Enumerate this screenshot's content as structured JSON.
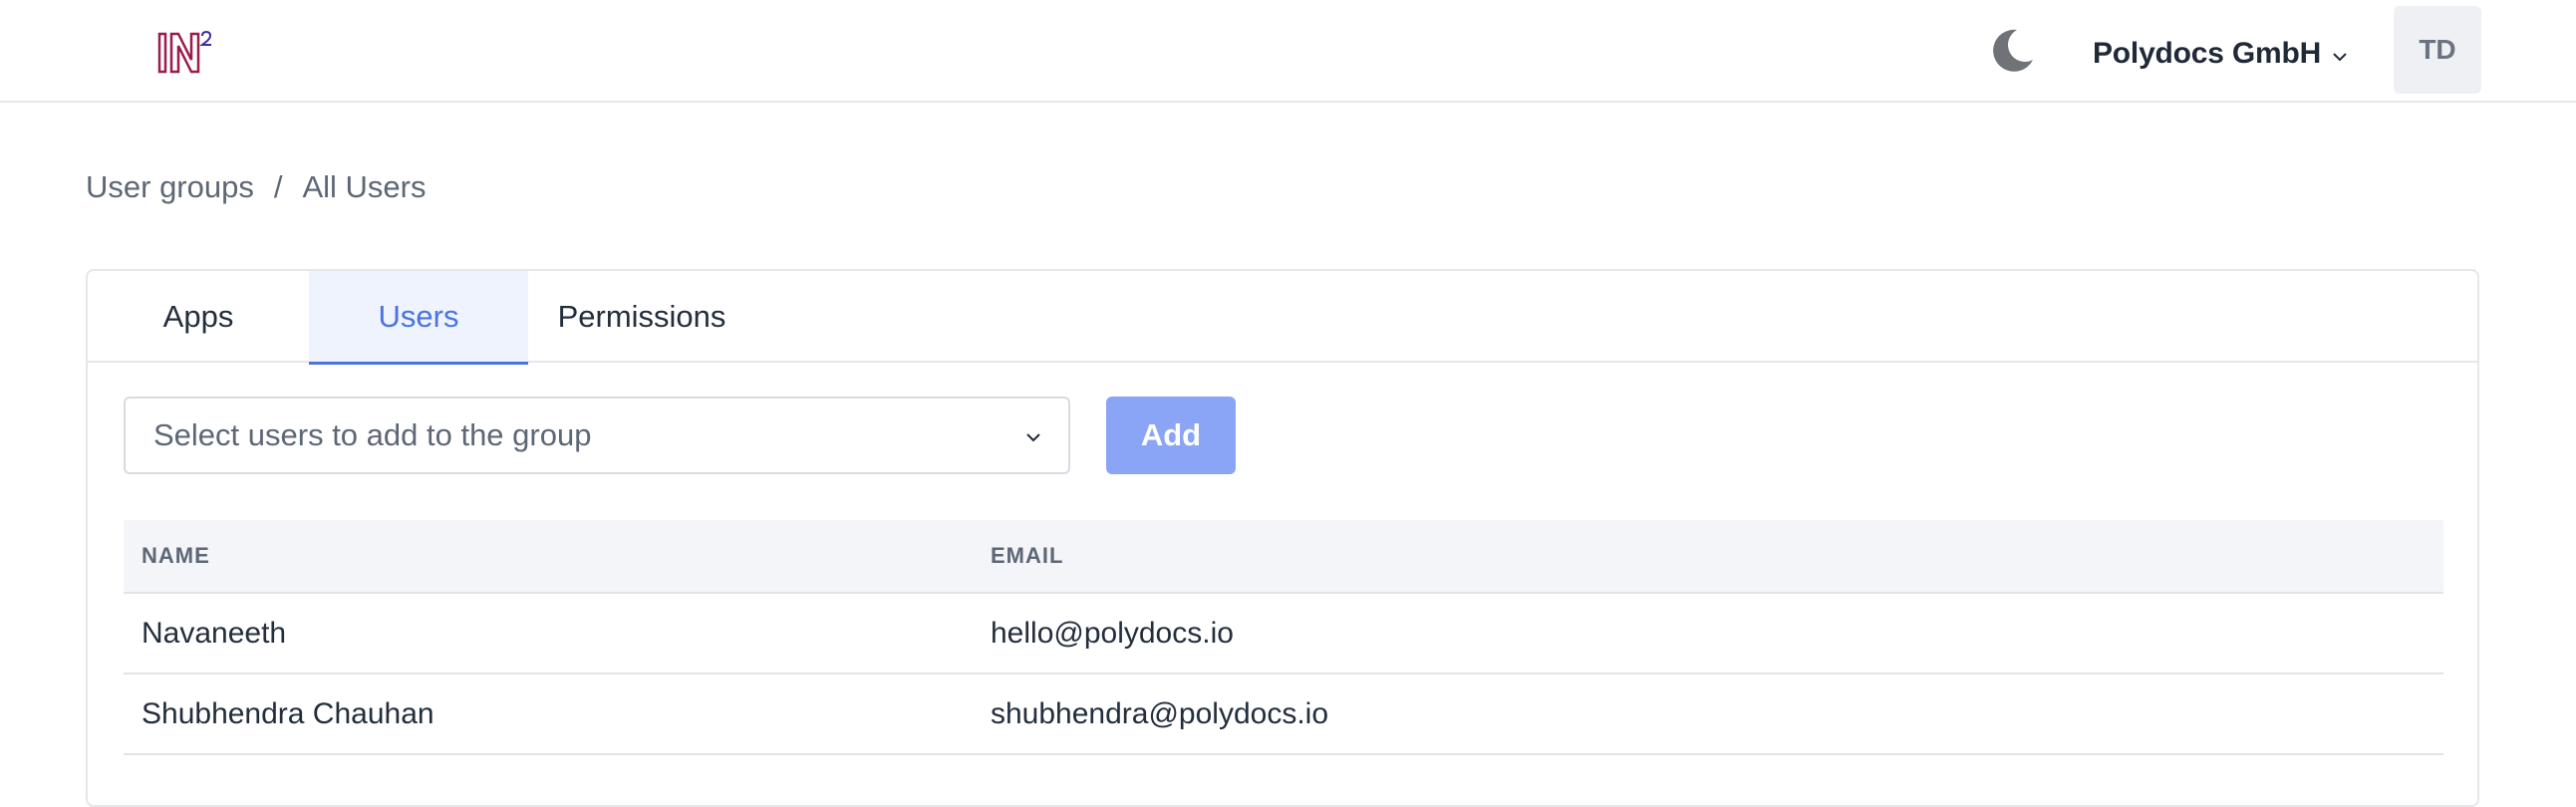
{
  "navbar": {
    "logo_text": "IN²",
    "org_name": "Polydocs GmbH",
    "avatar_initials": "TD"
  },
  "breadcrumb": {
    "items": [
      "User groups",
      "All Users"
    ],
    "separator": "/"
  },
  "tabs": [
    {
      "label": "Apps",
      "active": false
    },
    {
      "label": "Users",
      "active": true
    },
    {
      "label": "Permissions",
      "active": false
    }
  ],
  "add_users": {
    "placeholder": "Select users to add to the group",
    "add_label": "Add"
  },
  "table": {
    "columns": [
      "NAME",
      "EMAIL"
    ],
    "rows": [
      {
        "name": "Navaneeth",
        "email": "hello@polydocs.io"
      },
      {
        "name": "Shubhendra Chauhan",
        "email": "shubhendra@polydocs.io"
      }
    ]
  },
  "colors": {
    "accent": "#4a73e0",
    "add_button": "#8aa5f5",
    "logo_primary": "#9b1b4a",
    "logo_secondary": "#3b2f9e"
  },
  "icons": {
    "theme_toggle": "moon-icon",
    "org_dropdown": "chevron-down-icon",
    "select_dropdown": "chevron-down-icon"
  }
}
